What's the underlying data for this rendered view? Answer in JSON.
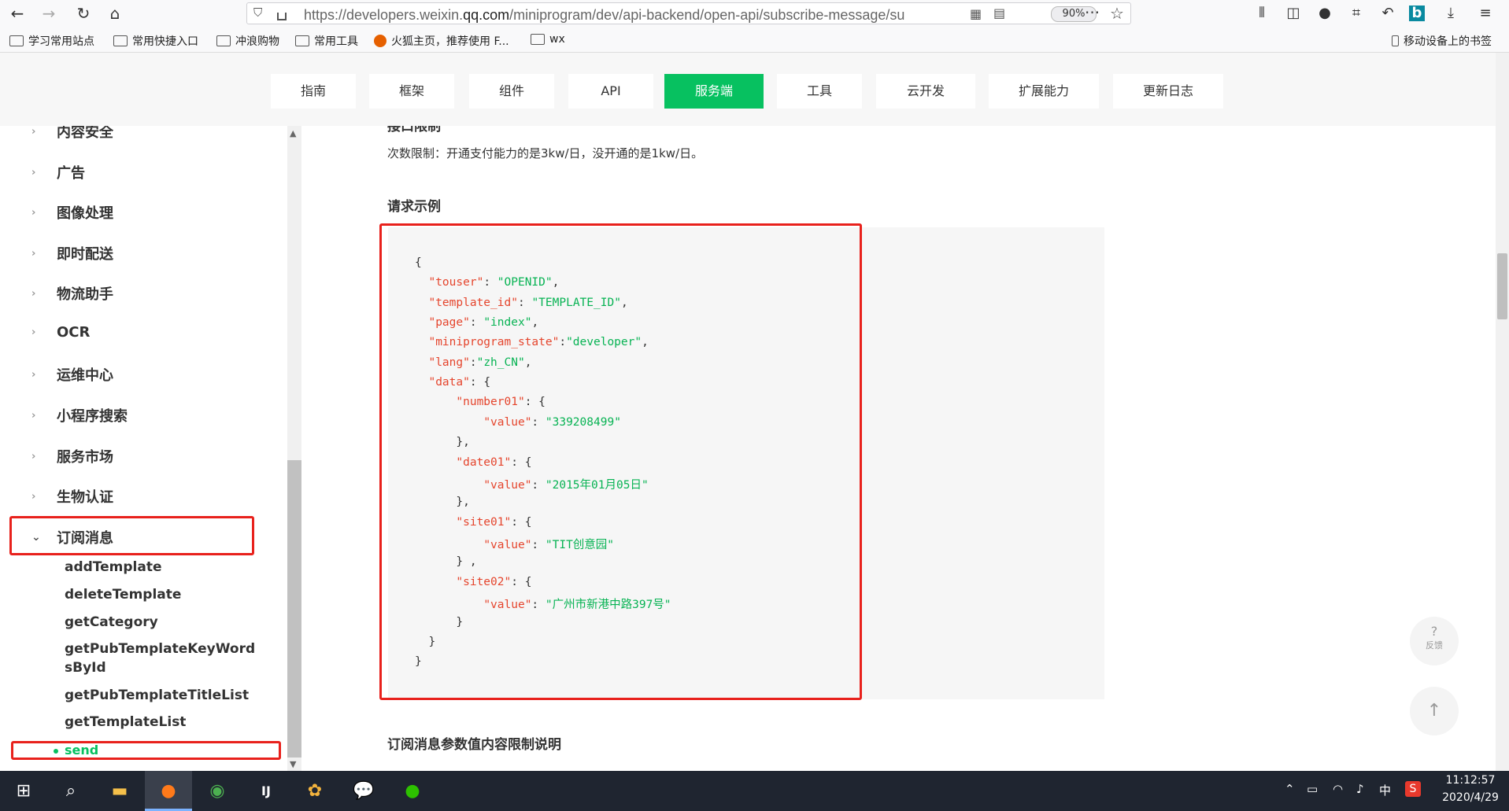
{
  "browser": {
    "url_prefix": "https://developers.weixin.",
    "url_domain": "qq.com",
    "url_suffix": "/miniprogram/dev/api-backend/open-api/subscribe-message/su",
    "zoom": "90%",
    "bookmarks": [
      "学习常用站点",
      "常用快捷入口",
      "冲浪购物",
      "常用工具",
      "火狐主页，推荐使用 F...",
      "wx"
    ],
    "mobile_bookmarks": "移动设备上的书签"
  },
  "nav": {
    "tabs": [
      "指南",
      "框架",
      "组件",
      "API",
      "服务端",
      "工具",
      "云开发",
      "扩展能力",
      "更新日志"
    ],
    "active_tab": "服务端"
  },
  "sidebar": {
    "items": [
      "内容安全",
      "广告",
      "图像处理",
      "即时配送",
      "物流助手",
      "OCR",
      "运维中心",
      "小程序搜索",
      "服务市场",
      "生物认证"
    ],
    "expanded": "订阅消息",
    "sub_items": [
      "addTemplate",
      "deleteTemplate",
      "getCategory",
      "getPubTemplateKeyWordsById",
      "getPubTemplateTitleList",
      "getTemplateList"
    ],
    "active_sub": "send"
  },
  "content": {
    "cut_heading": "接口限制",
    "limit_text": "次数限制：开通支付能力的是3kw/日，没开通的是1kw/日。",
    "request_heading": "请求示例",
    "code": {
      "open": "{",
      "touser_key": "\"touser\"",
      "touser_val": "\"OPENID\"",
      "template_key": "\"template_id\"",
      "template_val": "\"TEMPLATE_ID\"",
      "page_key": "\"page\"",
      "page_val": "\"index\"",
      "state_key": "\"miniprogram_state\"",
      "state_val": "\"developer\"",
      "lang_key": "\"lang\"",
      "lang_val": "\"zh_CN\"",
      "data_key": "\"data\"",
      "number_key": "\"number01\"",
      "number_val": "\"339208499\"",
      "date_key": "\"date01\"",
      "date_val": "\"2015年01月05日\"",
      "site1_key": "\"site01\"",
      "site1_val": "\"TIT创意园\"",
      "site2_key": "\"site02\"",
      "site2_val": "\"广州市新港中路397号\"",
      "value_key": "\"value\"",
      "close": "}"
    },
    "next_heading": "订阅消息参数值内容限制说明"
  },
  "float": {
    "feedback_icon": "?",
    "feedback_label": "反馈",
    "top_icon": "↑"
  },
  "taskbar": {
    "time": "11:12:57",
    "date": "2020/4/29",
    "ime": "中"
  },
  "colors": {
    "accent": "#07c160",
    "highlight_box": "#e8211c"
  }
}
